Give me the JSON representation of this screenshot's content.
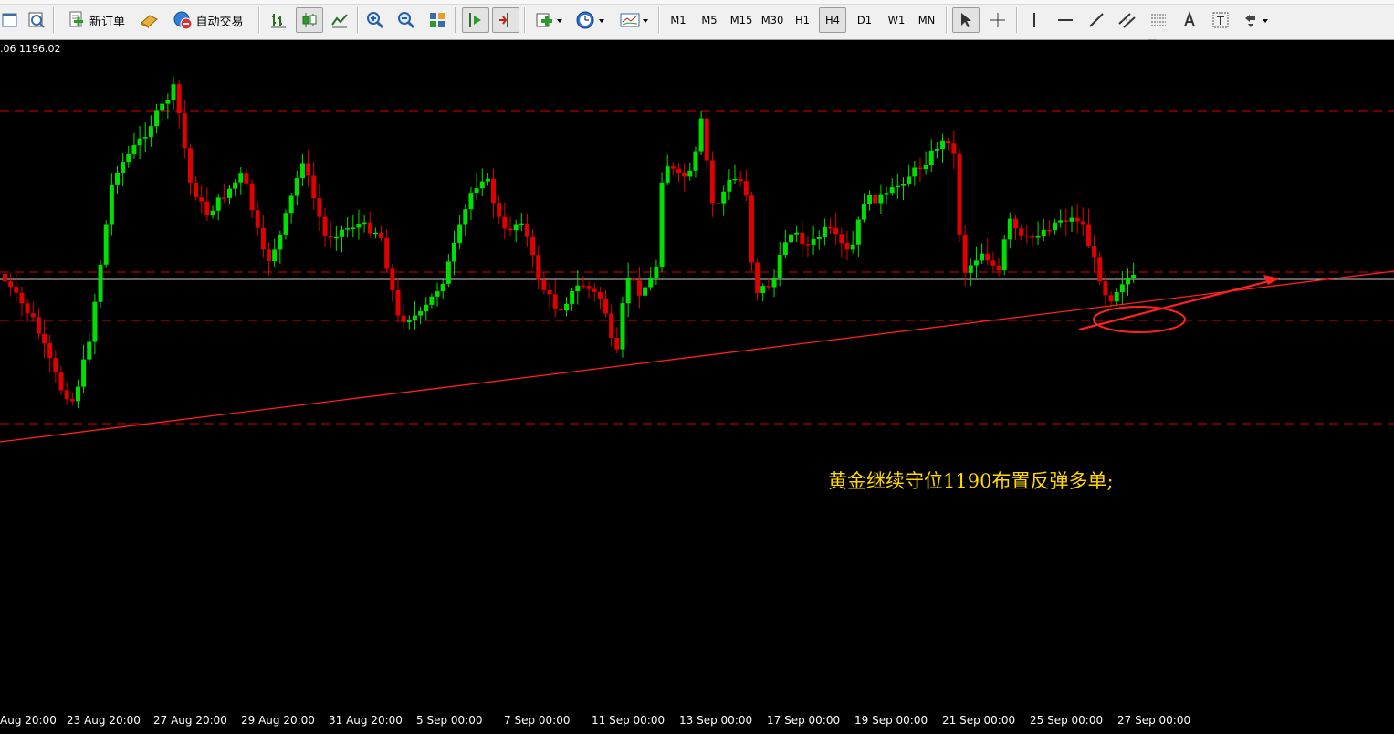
{
  "toolbar": {
    "new_order_label": "新订单",
    "auto_trade_label": "自动交易",
    "timeframes": [
      "M1",
      "M5",
      "M15",
      "M30",
      "H1",
      "H4",
      "D1",
      "W1",
      "MN"
    ],
    "active_timeframe": "H4"
  },
  "chart": {
    "price_info": ".06 1196.02",
    "annotation": "黄金继续守位1190布置反弹多单;",
    "x_ticks": [
      "Aug 20:00",
      "23 Aug 20:00",
      "27 Aug 20:00",
      "29 Aug 20:00",
      "31 Aug 20:00",
      "5 Sep 00:00",
      "7 Sep 00:00",
      "11 Sep 00:00",
      "13 Sep 00:00",
      "17 Sep 00:00",
      "19 Sep 00:00",
      "21 Sep 00:00",
      "25 Sep 00:00",
      "27 Sep 00:00"
    ],
    "colors": {
      "background": "#000000",
      "bull": "#00e000",
      "bear": "#e00000",
      "level": "#e00000",
      "trendline": "#ff2020",
      "annotation": "#ffd800"
    }
  }
}
